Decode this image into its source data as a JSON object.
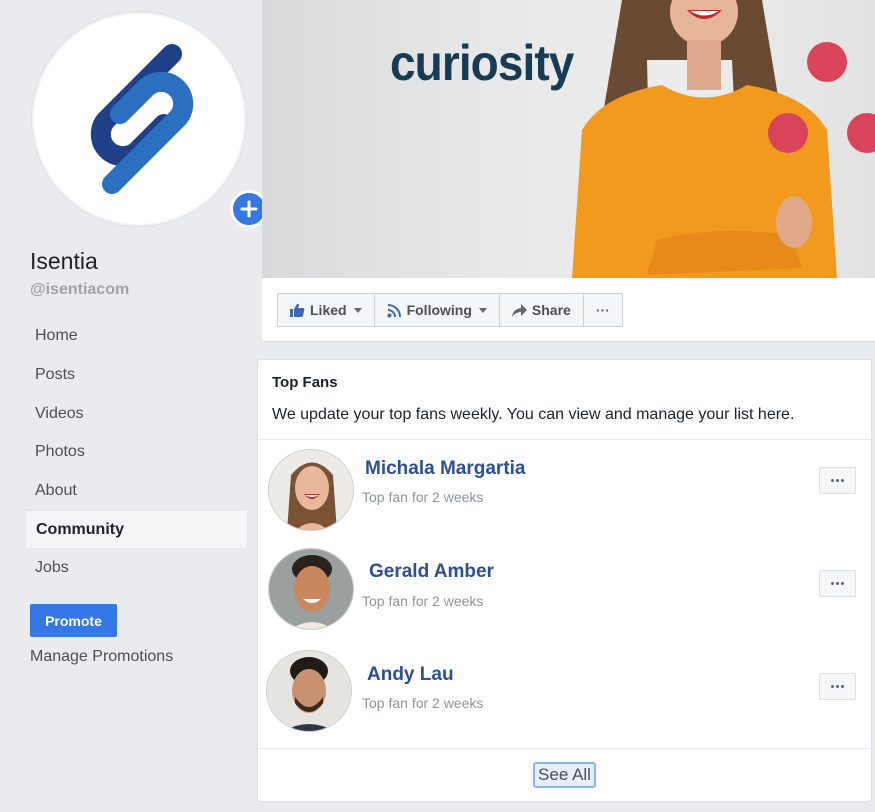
{
  "page": {
    "name": "Isentia",
    "handle": "@isentiacom"
  },
  "sidebar": {
    "items": [
      {
        "label": "Home",
        "active": false
      },
      {
        "label": "Posts",
        "active": false
      },
      {
        "label": "Videos",
        "active": false
      },
      {
        "label": "Photos",
        "active": false
      },
      {
        "label": "About",
        "active": false
      },
      {
        "label": "Community",
        "active": true
      },
      {
        "label": "Jobs",
        "active": false
      }
    ],
    "promote_label": "Promote",
    "manage_promotions_label": "Manage Promotions"
  },
  "cover": {
    "headline": "curiosity"
  },
  "actions": {
    "liked_label": "Liked",
    "following_label": "Following",
    "share_label": "Share",
    "more_label": "···"
  },
  "top_fans": {
    "title": "Top Fans",
    "description": "We update your top fans weekly. You can view and manage your list here.",
    "fans": [
      {
        "name": "Michala Margartia",
        "subtitle": "Top fan for 2 weeks"
      },
      {
        "name": "Gerald Amber",
        "subtitle": "Top fan for 2 weeks"
      },
      {
        "name": "Andy Lau",
        "subtitle": "Top fan for 2 weeks"
      }
    ],
    "see_all_label": "See All"
  },
  "colors": {
    "brand_blue": "#3578e5",
    "link_blue": "#2e4f96",
    "logo_dark": "#1f3f86",
    "logo_light": "#2a6fc0",
    "cover_text": "#173b52",
    "accent_red": "#d9445a",
    "shirt_orange": "#f29a1d"
  }
}
